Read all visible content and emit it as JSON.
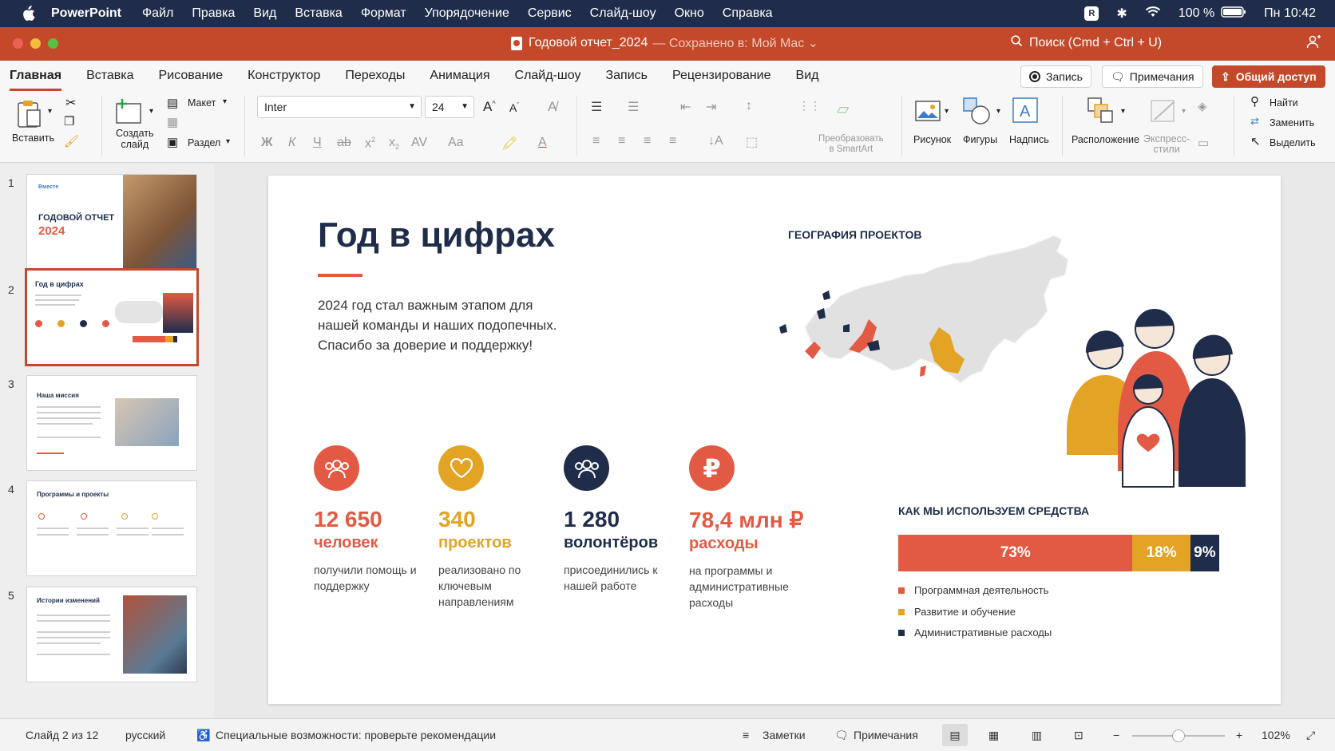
{
  "menubar": {
    "app": "PowerPoint",
    "items": [
      "Файл",
      "Правка",
      "Вид",
      "Вставка",
      "Формат",
      "Упорядочение",
      "Сервис",
      "Слайд-шоу",
      "Окно",
      "Справка"
    ],
    "battery": "100 %",
    "clock": "Пн 10:42"
  },
  "titlebar": {
    "doc_name": "Годовой отчет_2024",
    "saved": "— Сохранено в: Мой Mac ⌄",
    "search": "Поиск (Cmd + Ctrl + U)"
  },
  "ribbon": {
    "tabs": [
      "Главная",
      "Вставка",
      "Рисование",
      "Конструктор",
      "Переходы",
      "Анимация",
      "Слайд-шоу",
      "Запись",
      "Рецензирование",
      "Вид"
    ],
    "record_btn": "Запись",
    "comments_btn": "Примечания",
    "share_btn": "Общий доступ",
    "paste": "Вставить",
    "new_slide": "Создать\nслайд",
    "layout": "Макет",
    "section": "Раздел",
    "font": "Inter",
    "font_size": "24",
    "smartart": "Преобразовать\nв SmartArt",
    "picture": "Рисунок",
    "shapes": "Фигуры",
    "textbox": "Надпись",
    "arrange": "Расположение",
    "quick_styles": "Экспресс-\nстили",
    "find": "Найти",
    "replace": "Заменить",
    "select": "Выделить"
  },
  "thumbnails": {
    "t1_brand": "Вместе",
    "t1_title": "ГОДОВОЙ ОТЧЕТ",
    "t1_year": "2024",
    "t2_title": "Год в цифрах",
    "t3_title": "Наша миссия",
    "t4_title": "Программы и проекты",
    "t5_title": "Истории изменений"
  },
  "slide": {
    "title": "Год в цифрах",
    "lead": "2024 год стал важным этапом для нашей команды и наших подопечных. Спасибо за доверие и поддержку!",
    "geo_title": "ГЕОГРАФИЯ ПРОЕКТОВ",
    "stats": [
      {
        "num": "12 650",
        "unit": "человек",
        "desc": "получили помощь и поддержку",
        "color": "#e35a44"
      },
      {
        "num": "340",
        "unit": "проектов",
        "desc": "реализовано по ключевым направлениям",
        "color": "#e3a325"
      },
      {
        "num": "1 280",
        "unit": "волонтёров",
        "desc": "присоединились к нашей работе",
        "color": "#1f2d4b"
      },
      {
        "num": "78,4 млн ₽",
        "unit": "расходы",
        "desc": "на программы и административные расходы",
        "color": "#e35a44"
      }
    ],
    "funds_title": "КАК МЫ ИСПОЛЬЗУЕМ СРЕДСТВА",
    "chart_data": {
      "type": "bar",
      "categories": [
        "Программная деятельность",
        "Развитие и обучение",
        "Административные расходы"
      ],
      "values": [
        73,
        18,
        9
      ],
      "labels": [
        "73%",
        "18%",
        "9%"
      ],
      "colors": [
        "#e35a44",
        "#e3a325",
        "#1f2d4b"
      ]
    }
  },
  "statusbar": {
    "slide_pos": "Слайд 2 из 12",
    "lang": "русский",
    "accessibility": "Специальные возможности: проверьте рекомендации",
    "notes": "Заметки",
    "comments": "Примечания",
    "zoom": "102%"
  }
}
